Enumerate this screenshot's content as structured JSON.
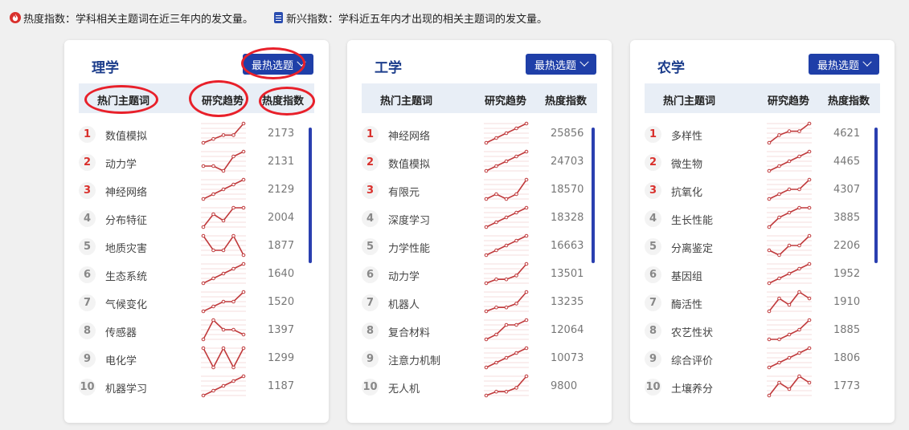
{
  "legend": {
    "heat": "热度指数：学科相关主题词在近三年内的发文量。",
    "emerging": "新兴指数：学科近五年内才出现的相关主题词的发文量。"
  },
  "panels": [
    {
      "title": "理学",
      "button": "最热选题",
      "headers": {
        "keyword": "热门主题词",
        "trend": "研究趋势",
        "heat": "热度指数"
      },
      "rows": [
        {
          "rank": "1",
          "keyword": "数值模拟",
          "heat": "2173",
          "trend": [
            1,
            2,
            3,
            3,
            6
          ]
        },
        {
          "rank": "2",
          "keyword": "动力学",
          "heat": "2131",
          "trend": [
            3,
            3,
            2,
            5,
            6
          ]
        },
        {
          "rank": "3",
          "keyword": "神经网络",
          "heat": "2129",
          "trend": [
            1,
            2,
            3,
            4,
            5
          ]
        },
        {
          "rank": "4",
          "keyword": "分布特征",
          "heat": "2004",
          "trend": [
            1,
            3,
            2,
            4,
            4
          ]
        },
        {
          "rank": "5",
          "keyword": "地质灾害",
          "heat": "1877",
          "trend": [
            5,
            2,
            2,
            5,
            1
          ]
        },
        {
          "rank": "6",
          "keyword": "生态系统",
          "heat": "1640",
          "trend": [
            1,
            2,
            3,
            4,
            5
          ]
        },
        {
          "rank": "7",
          "keyword": "气候变化",
          "heat": "1520",
          "trend": [
            1,
            2,
            3,
            3,
            5
          ]
        },
        {
          "rank": "8",
          "keyword": "传感器",
          "heat": "1397",
          "trend": [
            1,
            5,
            3,
            3,
            2
          ]
        },
        {
          "rank": "9",
          "keyword": "电化学",
          "heat": "1299",
          "trend": [
            4,
            1,
            4,
            1,
            4
          ]
        },
        {
          "rank": "10",
          "keyword": "机器学习",
          "heat": "1187",
          "trend": [
            1,
            2,
            3,
            4,
            5
          ]
        }
      ]
    },
    {
      "title": "工学",
      "button": "最热选题",
      "headers": {
        "keyword": "热门主题词",
        "trend": "研究趋势",
        "heat": "热度指数"
      },
      "rows": [
        {
          "rank": "1",
          "keyword": "神经网络",
          "heat": "25856",
          "trend": [
            1,
            2,
            3,
            4,
            5
          ]
        },
        {
          "rank": "2",
          "keyword": "数值模拟",
          "heat": "24703",
          "trend": [
            1,
            2,
            3,
            4,
            5
          ]
        },
        {
          "rank": "3",
          "keyword": "有限元",
          "heat": "18570",
          "trend": [
            2,
            3,
            2,
            3,
            6
          ]
        },
        {
          "rank": "4",
          "keyword": "深度学习",
          "heat": "18328",
          "trend": [
            1,
            2,
            3,
            4,
            5
          ]
        },
        {
          "rank": "5",
          "keyword": "力学性能",
          "heat": "16663",
          "trend": [
            1,
            2,
            3,
            4,
            5
          ]
        },
        {
          "rank": "6",
          "keyword": "动力学",
          "heat": "13501",
          "trend": [
            1,
            2,
            2,
            3,
            6
          ]
        },
        {
          "rank": "7",
          "keyword": "机器人",
          "heat": "13235",
          "trend": [
            1,
            2,
            2,
            3,
            6
          ]
        },
        {
          "rank": "8",
          "keyword": "复合材料",
          "heat": "12064",
          "trend": [
            1,
            2,
            4,
            4,
            5
          ]
        },
        {
          "rank": "9",
          "keyword": "注意力机制",
          "heat": "10073",
          "trend": [
            1,
            2,
            3,
            4,
            5
          ]
        },
        {
          "rank": "10",
          "keyword": "无人机",
          "heat": "9800",
          "trend": [
            1,
            2,
            2,
            3,
            6
          ]
        }
      ]
    },
    {
      "title": "农学",
      "button": "最热选题",
      "headers": {
        "keyword": "热门主题词",
        "trend": "研究趋势",
        "heat": "热度指数"
      },
      "rows": [
        {
          "rank": "1",
          "keyword": "多样性",
          "heat": "4621",
          "trend": [
            1,
            3,
            4,
            4,
            6
          ]
        },
        {
          "rank": "2",
          "keyword": "微生物",
          "heat": "4465",
          "trend": [
            1,
            2,
            3,
            4,
            5
          ]
        },
        {
          "rank": "3",
          "keyword": "抗氧化",
          "heat": "4307",
          "trend": [
            1,
            2,
            3,
            3,
            5
          ]
        },
        {
          "rank": "4",
          "keyword": "生长性能",
          "heat": "3885",
          "trend": [
            1,
            3,
            4,
            5,
            5
          ]
        },
        {
          "rank": "5",
          "keyword": "分离鉴定",
          "heat": "2206",
          "trend": [
            2,
            1,
            3,
            3,
            5
          ]
        },
        {
          "rank": "6",
          "keyword": "基因组",
          "heat": "1952",
          "trend": [
            1,
            2,
            3,
            4,
            5
          ]
        },
        {
          "rank": "7",
          "keyword": "酶活性",
          "heat": "1910",
          "trend": [
            1,
            3,
            2,
            4,
            3
          ]
        },
        {
          "rank": "8",
          "keyword": "农艺性状",
          "heat": "1885",
          "trend": [
            1,
            1,
            2,
            3,
            5
          ]
        },
        {
          "rank": "9",
          "keyword": "综合评价",
          "heat": "1806",
          "trend": [
            1,
            2,
            3,
            4,
            5
          ]
        },
        {
          "rank": "10",
          "keyword": "土壤养分",
          "heat": "1773",
          "trend": [
            1,
            3,
            2,
            4,
            3
          ]
        }
      ]
    }
  ],
  "colors": {
    "brand": "#1f3fa8",
    "trend_line": "#c0393b",
    "rank_top": "#d9302c",
    "annotation": "#e8202a"
  }
}
